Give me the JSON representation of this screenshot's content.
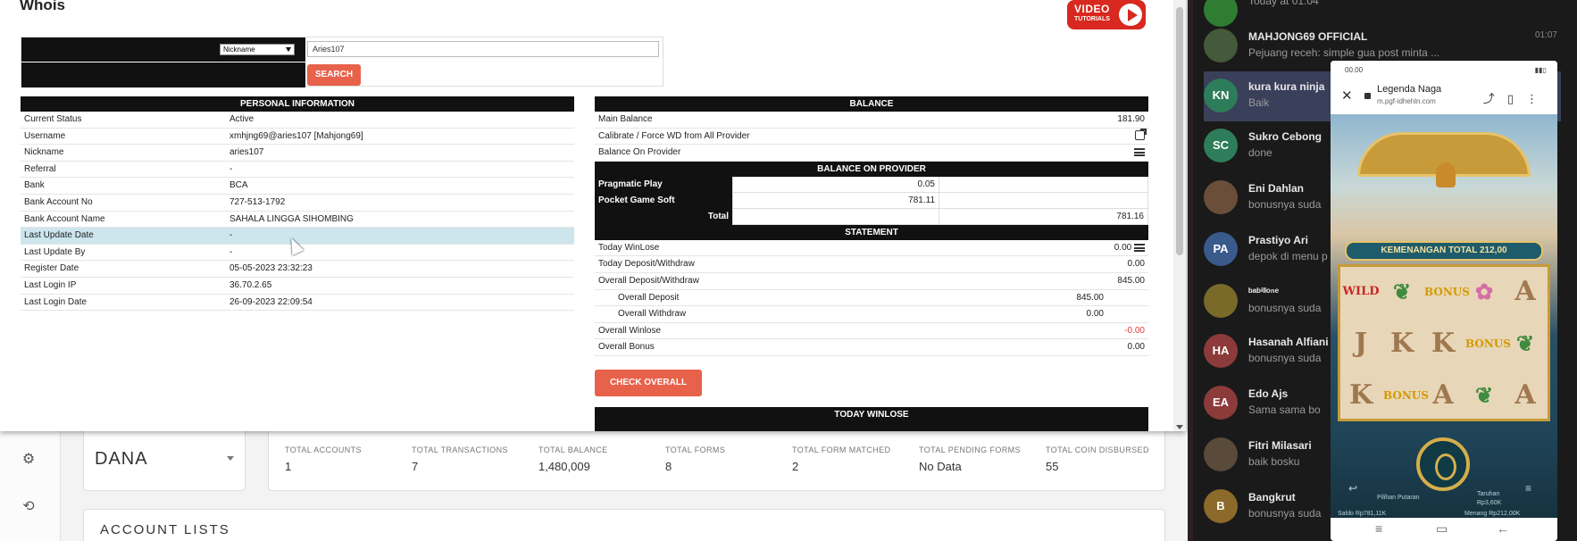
{
  "modal": {
    "title": "Whois",
    "video_badge": {
      "title": "VIDEO",
      "subtitle": "TUTORIALS"
    },
    "search": {
      "field_select": "Nickname",
      "input_value": "Aries107",
      "button": "SEARCH"
    },
    "personal": {
      "header": "PERSONAL INFORMATION",
      "rows": [
        {
          "k": "Current Status",
          "v": "Active"
        },
        {
          "k": "Username",
          "v": "xmhjng69@aries107  [Mahjong69]"
        },
        {
          "k": "Nickname",
          "v": "aries107"
        },
        {
          "k": "Referral",
          "v": "-"
        },
        {
          "k": "Bank",
          "v": "BCA"
        },
        {
          "k": "Bank Account No",
          "v": "727-513-1792"
        },
        {
          "k": "Bank Account Name",
          "v": "SAHALA LINGGA SIHOMBING"
        },
        {
          "k": "Last Update Date",
          "v": "-"
        },
        {
          "k": "Last Update By",
          "v": "-"
        },
        {
          "k": "Register Date",
          "v": "05-05-2023 23:32:23"
        },
        {
          "k": "Last Login IP",
          "v": "36.70.2.65"
        },
        {
          "k": "Last Login Date",
          "v": "26-09-2023 22:09:54"
        }
      ]
    },
    "balance": {
      "header": "BALANCE",
      "main_balance_label": "Main Balance",
      "main_balance": "181.90",
      "calibrate_label": "Calibrate / Force WD from All Provider",
      "on_provider_label": "Balance On Provider",
      "provider_header": "BALANCE ON PROVIDER",
      "providers": [
        {
          "name": "Pragmatic Play",
          "value": "0.05"
        },
        {
          "name": "Pocket Game Soft",
          "value": "781.11"
        }
      ],
      "total_label": "Total",
      "total_value": "781.16"
    },
    "statement": {
      "header": "STATEMENT",
      "today_winlose_label": "Today WinLose",
      "today_winlose": "0.00",
      "today_dw_label": "Today Deposit/Withdraw",
      "today_dw": "0.00",
      "overall_dw_label": "Overall Deposit/Withdraw",
      "overall_dw": "845.00",
      "overall_deposit_label": "Overall Deposit",
      "overall_deposit": "845.00",
      "overall_withdraw_label": "Overall Withdraw",
      "overall_withdraw": "0.00",
      "overall_winlose_label": "Overall Winlose",
      "overall_winlose": "-0.00",
      "overall_bonus_label": "Overall Bonus",
      "overall_bonus": "0.00"
    },
    "check_overall": "CHECK OVERALL",
    "today_winlose_header": "TODAY WINLOSE"
  },
  "dashboard": {
    "dana_label": "DANA",
    "stats": [
      {
        "t": "TOTAL ACCOUNTS",
        "v": "1"
      },
      {
        "t": "TOTAL TRANSACTIONS",
        "v": "7"
      },
      {
        "t": "TOTAL BALANCE",
        "v": "1,480,009"
      },
      {
        "t": "TOTAL FORMS",
        "v": "8"
      },
      {
        "t": "TOTAL FORM MATCHED",
        "v": "2"
      },
      {
        "t": "TOTAL PENDING FORMS",
        "v": "No Data"
      },
      {
        "t": "TOTAL COIN DISBURSED",
        "v": "55"
      }
    ],
    "account_lists": "ACCOUNT LISTS"
  },
  "chat": {
    "items": [
      {
        "name": "Today at 01:04",
        "msg": "",
        "time": "",
        "initials": "",
        "color": "#2e7d32"
      },
      {
        "name": "MAHJONG69 OFFICIAL",
        "msg": "Pejuang receh: simple gua post minta ...",
        "time": "01:07",
        "initials": "",
        "color": "#445a3a"
      },
      {
        "name": "kura kura ninja",
        "msg": "Baik",
        "time": "",
        "initials": "KN",
        "color": "#2e7d5a"
      },
      {
        "name": "Sukro Cebong",
        "msg": "done",
        "time": "",
        "initials": "SC",
        "color": "#2e7d5a"
      },
      {
        "name": "Eni Dahlan",
        "msg": "bonusnya suda",
        "time": "",
        "initials": "",
        "color": "#6b4e3a"
      },
      {
        "name": "Prastiyo Ari",
        "msg": "depok di menu p",
        "time": "",
        "initials": "PA",
        "color": "#3a5a8c"
      },
      {
        "name": "ᵇᵃᵇⁱˡˡᵒⁿᵉ",
        "msg": "bonusnya suda",
        "time": "",
        "initials": "",
        "color": "#7a6a2a"
      },
      {
        "name": "Hasanah Alfiani",
        "msg": "bonusnya suda",
        "time": "",
        "initials": "HA",
        "color": "#8c3a3a"
      },
      {
        "name": "Edo Ajs",
        "msg": "Sama sama bo",
        "time": "",
        "initials": "EA",
        "color": "#8c3a3a"
      },
      {
        "name": "Fitri Milasari",
        "msg": "baik bosku",
        "time": "",
        "initials": "",
        "color": "#5a4a3a"
      },
      {
        "name": "Bangkrut",
        "msg": "bonusnya suda",
        "time": "",
        "initials": "B",
        "color": "#8c6a2a"
      }
    ]
  },
  "phone": {
    "status_time": "00.00",
    "page_title": "Legenda Naga",
    "page_url": "m.pgf-idhehln.com",
    "banner": "KEMENANGAN TOTAL 212,00",
    "buttons": [
      "Pilihan Putaran",
      "Taruhan",
      "Rp3,60K"
    ],
    "saldo": "Saldo Rp781,11K",
    "menang": "Menang Rp212,00K"
  }
}
